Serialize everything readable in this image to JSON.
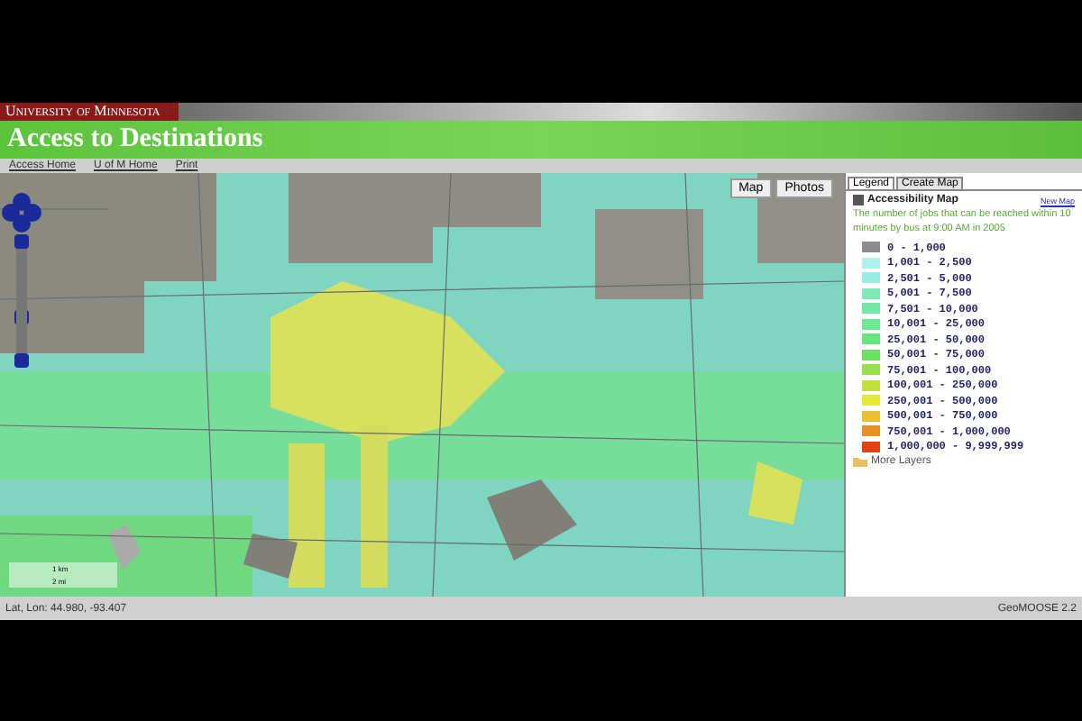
{
  "header": {
    "university": "University of Minnesota",
    "title": "Access to Destinations"
  },
  "nav_links": [
    "Access Home",
    "U of M Home",
    "Print"
  ],
  "map": {
    "view_buttons": [
      {
        "label": "Map",
        "selected": false
      },
      {
        "label": "Photos",
        "selected": false
      }
    ],
    "scale": {
      "metric": "1 km",
      "imperial": "2 mi"
    }
  },
  "panel": {
    "tabs": [
      {
        "label": "Legend",
        "selected": true
      },
      {
        "label": "Create Map",
        "selected": false
      }
    ],
    "layer": {
      "name": "Accessibility Map",
      "checked": true,
      "link": "New Map",
      "description": "The number of jobs that can be reached within 10 minutes by bus at 9:00 AM in 2005"
    },
    "legend": [
      {
        "label": "0 - 1,000",
        "color": "#8c8c8c"
      },
      {
        "label": "1,001 - 2,500",
        "color": "#aef0f0"
      },
      {
        "label": "2,501 - 5,000",
        "color": "#98eee0"
      },
      {
        "label": "5,001 - 7,500",
        "color": "#80eab8"
      },
      {
        "label": "7,501 - 10,000",
        "color": "#74e8a4"
      },
      {
        "label": "10,001 - 25,000",
        "color": "#6ee890"
      },
      {
        "label": "25,001 - 50,000",
        "color": "#66e67c"
      },
      {
        "label": "50,001 - 75,000",
        "color": "#70e064"
      },
      {
        "label": "75,001 - 100,000",
        "color": "#96e050"
      },
      {
        "label": "100,001 - 250,000",
        "color": "#c4e040"
      },
      {
        "label": "250,001 - 500,000",
        "color": "#e8e838"
      },
      {
        "label": "500,001 - 750,000",
        "color": "#e8c030"
      },
      {
        "label": "750,001 - 1,000,000",
        "color": "#e89024"
      },
      {
        "label": "1,000,000 - 9,999,999",
        "color": "#e04414"
      }
    ],
    "more_layers": "More Layers"
  },
  "status_bar": {
    "coordinates": "Lat, Lon: 44.980, -93.407",
    "version": "GeoMOOSE 2.2"
  }
}
